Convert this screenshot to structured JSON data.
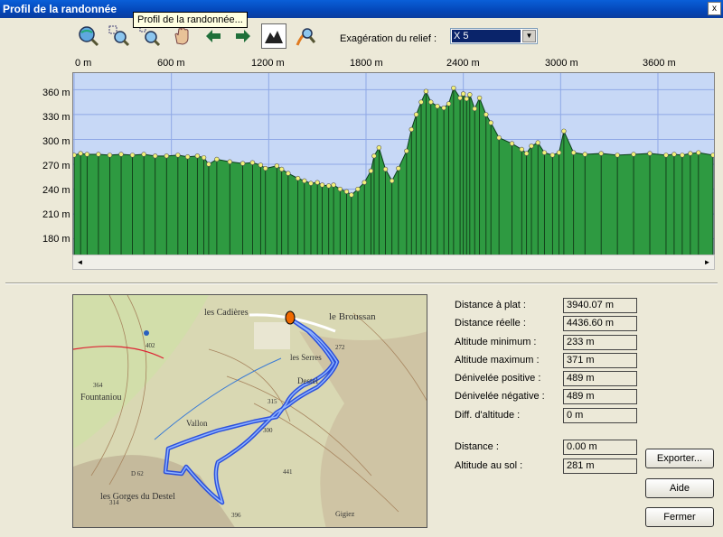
{
  "window": {
    "title": "Profil de la randonnée",
    "close_label": "x"
  },
  "toolbar": {
    "tooltip": "Profil de la randonnée...",
    "buttons": [
      {
        "name": "zoom-globe-icon"
      },
      {
        "name": "zoom-in-icon"
      },
      {
        "name": "zoom-out-icon"
      },
      {
        "name": "pan-hand-icon"
      },
      {
        "name": "arrow-left-icon"
      },
      {
        "name": "arrow-right-icon"
      },
      {
        "name": "profile-view-icon"
      },
      {
        "name": "search-path-icon"
      }
    ],
    "exaggeration_label": "Exagération du relief :",
    "exaggeration_value": "X 5"
  },
  "chart_data": {
    "type": "area",
    "x_tick_labels": [
      "0 m",
      "600 m",
      "1200 m",
      "1800 m",
      "2400 m",
      "3000 m",
      "3600 m"
    ],
    "y_tick_labels": [
      "360 m",
      "330 m",
      "300 m",
      "270 m",
      "240 m",
      "210 m",
      "180 m"
    ],
    "xlim": [
      0,
      3940
    ],
    "ylim": [
      160,
      380
    ],
    "fill_color": "#2e9a41",
    "background_color": "#c7d8f6",
    "point_color": "#f4f27a",
    "grid": true,
    "x": [
      0,
      40,
      80,
      150,
      220,
      290,
      360,
      430,
      500,
      570,
      640,
      700,
      760,
      800,
      830,
      880,
      960,
      1040,
      1100,
      1150,
      1180,
      1250,
      1280,
      1320,
      1380,
      1420,
      1460,
      1500,
      1530,
      1570,
      1600,
      1640,
      1680,
      1710,
      1750,
      1790,
      1830,
      1850,
      1880,
      1920,
      1960,
      2000,
      2050,
      2080,
      2110,
      2140,
      2170,
      2200,
      2240,
      2280,
      2310,
      2340,
      2380,
      2400,
      2420,
      2440,
      2470,
      2500,
      2540,
      2570,
      2620,
      2700,
      2760,
      2790,
      2820,
      2860,
      2900,
      2950,
      2990,
      3020,
      3080,
      3150,
      3250,
      3350,
      3450,
      3550,
      3650,
      3700,
      3750,
      3800,
      3850,
      3940
    ],
    "y": [
      281,
      283,
      282,
      282,
      281,
      282,
      281,
      282,
      280,
      280,
      281,
      279,
      280,
      278,
      270,
      276,
      273,
      271,
      272,
      269,
      265,
      268,
      264,
      259,
      253,
      250,
      247,
      248,
      245,
      244,
      245,
      240,
      237,
      233,
      240,
      248,
      262,
      280,
      290,
      264,
      250,
      265,
      286,
      312,
      330,
      345,
      358,
      345,
      340,
      338,
      343,
      362,
      350,
      355,
      349,
      354,
      337,
      350,
      330,
      320,
      302,
      295,
      288,
      283,
      292,
      296,
      284,
      281,
      284,
      310,
      284,
      282,
      283,
      281,
      282,
      283,
      281,
      282,
      281,
      283,
      284,
      281
    ]
  },
  "scroll": {
    "left": "◄",
    "right": "►"
  },
  "map": {
    "labels": [
      "les Cadières",
      "le Broussan",
      "Fountaniou",
      "les Serres",
      "402",
      "364",
      "272",
      "315",
      "300",
      "441",
      "396",
      "314",
      "D 62",
      "Vallon",
      "Destel",
      "les Gorges du Destel",
      "Gigiez"
    ]
  },
  "stats": [
    {
      "label": "Distance à plat :",
      "value": "3940.07 m"
    },
    {
      "label": "Distance réelle :",
      "value": "4436.60 m"
    },
    {
      "label": "Altitude minimum :",
      "value": "233 m"
    },
    {
      "label": "Altitude maximum :",
      "value": "371 m"
    },
    {
      "label": "Dénivelée positive :",
      "value": "489 m"
    },
    {
      "label": "Dénivelée négative :",
      "value": "489 m"
    },
    {
      "label": "Diff. d'altitude :",
      "value": "0 m"
    }
  ],
  "cursor": [
    {
      "label": "Distance :",
      "value": "0.00 m"
    },
    {
      "label": "Altitude au sol :",
      "value": "281 m"
    }
  ],
  "buttons": {
    "export": "Exporter...",
    "help": "Aide",
    "close": "Fermer"
  }
}
